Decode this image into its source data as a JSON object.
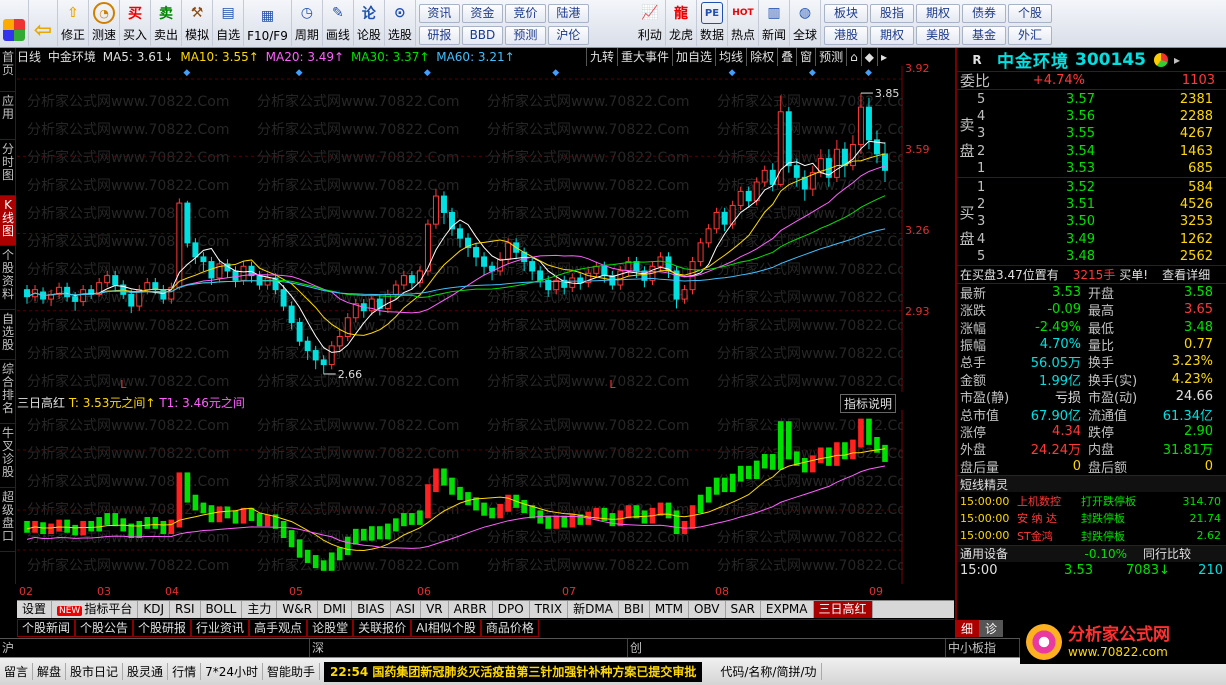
{
  "toolbar": {
    "big_buttons": [
      {
        "label": "",
        "icon": "menu-icon"
      },
      {
        "label": "",
        "icon": "back-arrow-icon"
      },
      {
        "label": "修正",
        "icon": "up-arrow-icon"
      },
      {
        "label": "测速",
        "icon": "clock-icon"
      },
      {
        "label": "买入",
        "icon": "buy-icon"
      },
      {
        "label": "卖出",
        "icon": "sell-icon"
      },
      {
        "label": "模拟",
        "icon": "hammer-icon"
      },
      {
        "label": "自选",
        "icon": "star-icon"
      },
      {
        "label": "F10/F9",
        "icon": "f10-icon"
      },
      {
        "label": "周期",
        "icon": "period-icon"
      },
      {
        "label": "画线",
        "icon": "pen-icon"
      },
      {
        "label": "论股",
        "icon": "forum-icon"
      },
      {
        "label": "选股",
        "icon": "select-icon"
      }
    ],
    "grid1": [
      "资讯",
      "资金",
      "竞价",
      "陆港",
      "研报",
      "BBD",
      "预测",
      "沪伦"
    ],
    "big_buttons2": [
      {
        "label": "利动",
        "icon": "chart-icon"
      },
      {
        "label": "龙虎",
        "icon": "dragon-icon"
      },
      {
        "label": "数据",
        "icon": "pe-icon"
      },
      {
        "label": "热点",
        "icon": "hot-icon"
      },
      {
        "label": "新闻",
        "icon": "news-icon"
      },
      {
        "label": "全球",
        "icon": "globe-icon"
      }
    ],
    "grid2": [
      "板块",
      "股指",
      "期权",
      "债券",
      "个股",
      "港股",
      "期权",
      "美股",
      "基金",
      "外汇"
    ]
  },
  "left_tabs": [
    "首页",
    "应用",
    "分时图",
    "K线图",
    "个股资料",
    "自选股",
    "综合排名",
    "牛叉诊股",
    "超级盘口"
  ],
  "chart": {
    "header": {
      "period": "日线",
      "name": "中金环境",
      "ma5": "MA5: 3.61↓",
      "ma10": "MA10: 3.55↑",
      "ma20": "MA20: 3.49↑",
      "ma30": "MA30: 3.37↑",
      "ma60": "MA60: 3.21↑"
    },
    "tools": [
      "九转",
      "重大事件",
      "加自选",
      "均线",
      "除权",
      "叠",
      "窗",
      "预测",
      "⌂",
      "◆",
      "▸"
    ],
    "price_axis": [
      "3.92",
      "3.59",
      "3.26",
      "2.93"
    ],
    "high_label": "3.85",
    "low_label": "2.66",
    "watermark": "分析家公式网www.70822.Com",
    "sub_header": {
      "name": "三日高红",
      "t": "T: 3.53元之间↑",
      "t1": "T1: 3.46元之间"
    },
    "sub_button": "指标说明",
    "x_dates": [
      "02",
      "03",
      "04",
      "05",
      "06",
      "07",
      "08",
      "09"
    ]
  },
  "chart_data": {
    "type": "candlestick",
    "title": "中金环境 日线",
    "ylim": [
      2.6,
      3.95
    ],
    "candles": [
      {
        "o": 3.02,
        "c": 2.99,
        "h": 3.04,
        "l": 2.96
      },
      {
        "o": 2.99,
        "c": 3.02,
        "h": 3.04,
        "l": 2.97
      },
      {
        "o": 3.01,
        "c": 2.98,
        "h": 3.03,
        "l": 2.96
      },
      {
        "o": 2.98,
        "c": 3.0,
        "h": 3.02,
        "l": 2.95
      },
      {
        "o": 3.0,
        "c": 3.03,
        "h": 3.05,
        "l": 2.98
      },
      {
        "o": 3.03,
        "c": 2.99,
        "h": 3.05,
        "l": 2.97
      },
      {
        "o": 2.99,
        "c": 2.97,
        "h": 3.01,
        "l": 2.93
      },
      {
        "o": 2.97,
        "c": 3.02,
        "h": 3.04,
        "l": 2.95
      },
      {
        "o": 3.02,
        "c": 3.0,
        "h": 3.04,
        "l": 2.98
      },
      {
        "o": 3.0,
        "c": 3.05,
        "h": 3.07,
        "l": 2.99
      },
      {
        "o": 3.05,
        "c": 3.08,
        "h": 3.1,
        "l": 3.03
      },
      {
        "o": 3.08,
        "c": 3.04,
        "h": 3.1,
        "l": 3.01
      },
      {
        "o": 3.04,
        "c": 3.0,
        "h": 3.06,
        "l": 2.98
      },
      {
        "o": 3.0,
        "c": 2.95,
        "h": 3.02,
        "l": 2.92
      },
      {
        "o": 2.95,
        "c": 3.02,
        "h": 3.04,
        "l": 2.93
      },
      {
        "o": 3.02,
        "c": 3.05,
        "h": 3.07,
        "l": 3.0
      },
      {
        "o": 3.05,
        "c": 3.02,
        "h": 3.07,
        "l": 3.0
      },
      {
        "o": 3.02,
        "c": 2.98,
        "h": 3.04,
        "l": 2.96
      },
      {
        "o": 2.98,
        "c": 3.03,
        "h": 3.05,
        "l": 2.96
      },
      {
        "o": 3.03,
        "c": 3.39,
        "h": 3.41,
        "l": 3.02
      },
      {
        "o": 3.39,
        "c": 3.22,
        "h": 3.4,
        "l": 3.2
      },
      {
        "o": 3.22,
        "c": 3.16,
        "h": 3.24,
        "l": 3.13
      },
      {
        "o": 3.16,
        "c": 3.14,
        "h": 3.18,
        "l": 3.1
      },
      {
        "o": 3.14,
        "c": 3.07,
        "h": 3.16,
        "l": 3.04
      },
      {
        "o": 3.07,
        "c": 3.13,
        "h": 3.15,
        "l": 3.05
      },
      {
        "o": 3.13,
        "c": 3.1,
        "h": 3.15,
        "l": 3.07
      },
      {
        "o": 3.1,
        "c": 3.06,
        "h": 3.12,
        "l": 3.03
      },
      {
        "o": 3.06,
        "c": 3.12,
        "h": 3.14,
        "l": 3.04
      },
      {
        "o": 3.12,
        "c": 3.08,
        "h": 3.14,
        "l": 3.05
      },
      {
        "o": 3.08,
        "c": 3.04,
        "h": 3.1,
        "l": 3.02
      },
      {
        "o": 3.04,
        "c": 3.07,
        "h": 3.09,
        "l": 3.02
      },
      {
        "o": 3.07,
        "c": 3.02,
        "h": 3.09,
        "l": 3.0
      },
      {
        "o": 3.02,
        "c": 2.95,
        "h": 3.04,
        "l": 2.93
      },
      {
        "o": 2.95,
        "c": 2.88,
        "h": 2.97,
        "l": 2.85
      },
      {
        "o": 2.88,
        "c": 2.8,
        "h": 2.9,
        "l": 2.78
      },
      {
        "o": 2.8,
        "c": 2.76,
        "h": 2.82,
        "l": 2.72
      },
      {
        "o": 2.76,
        "c": 2.72,
        "h": 2.78,
        "l": 2.68
      },
      {
        "o": 2.72,
        "c": 2.7,
        "h": 2.74,
        "l": 2.66
      },
      {
        "o": 2.7,
        "c": 2.78,
        "h": 2.8,
        "l": 2.68
      },
      {
        "o": 2.78,
        "c": 2.82,
        "h": 2.85,
        "l": 2.76
      },
      {
        "o": 2.82,
        "c": 2.9,
        "h": 2.92,
        "l": 2.8
      },
      {
        "o": 2.9,
        "c": 2.96,
        "h": 2.98,
        "l": 2.88
      },
      {
        "o": 2.96,
        "c": 2.93,
        "h": 2.98,
        "l": 2.9
      },
      {
        "o": 2.93,
        "c": 2.98,
        "h": 3.0,
        "l": 2.91
      },
      {
        "o": 2.98,
        "c": 2.94,
        "h": 3.0,
        "l": 2.91
      },
      {
        "o": 2.94,
        "c": 3.0,
        "h": 3.02,
        "l": 2.92
      },
      {
        "o": 3.0,
        "c": 3.04,
        "h": 3.06,
        "l": 2.98
      },
      {
        "o": 3.04,
        "c": 3.08,
        "h": 3.1,
        "l": 3.02
      },
      {
        "o": 3.08,
        "c": 3.05,
        "h": 3.1,
        "l": 3.02
      },
      {
        "o": 3.05,
        "c": 3.1,
        "h": 3.12,
        "l": 3.03
      },
      {
        "o": 3.1,
        "c": 3.3,
        "h": 3.32,
        "l": 3.08
      },
      {
        "o": 3.3,
        "c": 3.42,
        "h": 3.45,
        "l": 3.28
      },
      {
        "o": 3.42,
        "c": 3.35,
        "h": 3.44,
        "l": 3.3
      },
      {
        "o": 3.35,
        "c": 3.28,
        "h": 3.37,
        "l": 3.25
      },
      {
        "o": 3.28,
        "c": 3.24,
        "h": 3.3,
        "l": 3.2
      },
      {
        "o": 3.24,
        "c": 3.2,
        "h": 3.26,
        "l": 3.16
      },
      {
        "o": 3.2,
        "c": 3.16,
        "h": 3.22,
        "l": 3.12
      },
      {
        "o": 3.16,
        "c": 3.12,
        "h": 3.18,
        "l": 3.08
      },
      {
        "o": 3.12,
        "c": 3.1,
        "h": 3.14,
        "l": 3.06
      },
      {
        "o": 3.1,
        "c": 3.15,
        "h": 3.18,
        "l": 3.08
      },
      {
        "o": 3.15,
        "c": 3.22,
        "h": 3.24,
        "l": 3.13
      },
      {
        "o": 3.22,
        "c": 3.18,
        "h": 3.24,
        "l": 3.15
      },
      {
        "o": 3.18,
        "c": 3.14,
        "h": 3.2,
        "l": 3.1
      },
      {
        "o": 3.14,
        "c": 3.1,
        "h": 3.16,
        "l": 3.06
      },
      {
        "o": 3.1,
        "c": 3.06,
        "h": 3.12,
        "l": 3.03
      },
      {
        "o": 3.06,
        "c": 3.02,
        "h": 3.08,
        "l": 2.99
      },
      {
        "o": 3.02,
        "c": 3.06,
        "h": 3.08,
        "l": 3.0
      },
      {
        "o": 3.06,
        "c": 3.03,
        "h": 3.08,
        "l": 3.0
      },
      {
        "o": 3.03,
        "c": 3.07,
        "h": 3.09,
        "l": 3.01
      },
      {
        "o": 3.07,
        "c": 3.05,
        "h": 3.09,
        "l": 3.02
      },
      {
        "o": 3.05,
        "c": 3.09,
        "h": 3.11,
        "l": 3.03
      },
      {
        "o": 3.09,
        "c": 3.12,
        "h": 3.14,
        "l": 3.07
      },
      {
        "o": 3.12,
        "c": 3.08,
        "h": 3.14,
        "l": 3.05
      },
      {
        "o": 3.08,
        "c": 3.04,
        "h": 3.1,
        "l": 3.02
      },
      {
        "o": 3.04,
        "c": 3.1,
        "h": 3.12,
        "l": 3.02
      },
      {
        "o": 3.1,
        "c": 3.14,
        "h": 3.16,
        "l": 3.08
      },
      {
        "o": 3.14,
        "c": 3.1,
        "h": 3.16,
        "l": 3.07
      },
      {
        "o": 3.1,
        "c": 3.06,
        "h": 3.12,
        "l": 3.03
      },
      {
        "o": 3.06,
        "c": 3.12,
        "h": 3.14,
        "l": 3.04
      },
      {
        "o": 3.12,
        "c": 3.16,
        "h": 3.18,
        "l": 3.1
      },
      {
        "o": 3.16,
        "c": 3.1,
        "h": 3.18,
        "l": 3.07
      },
      {
        "o": 3.1,
        "c": 2.98,
        "h": 3.12,
        "l": 2.94
      },
      {
        "o": 2.98,
        "c": 3.02,
        "h": 3.04,
        "l": 2.96
      },
      {
        "o": 3.02,
        "c": 3.14,
        "h": 3.16,
        "l": 3.0
      },
      {
        "o": 3.14,
        "c": 3.22,
        "h": 3.24,
        "l": 3.12
      },
      {
        "o": 3.22,
        "c": 3.28,
        "h": 3.3,
        "l": 3.2
      },
      {
        "o": 3.28,
        "c": 3.35,
        "h": 3.37,
        "l": 3.26
      },
      {
        "o": 3.35,
        "c": 3.3,
        "h": 3.37,
        "l": 3.27
      },
      {
        "o": 3.3,
        "c": 3.38,
        "h": 3.4,
        "l": 3.28
      },
      {
        "o": 3.38,
        "c": 3.44,
        "h": 3.46,
        "l": 3.36
      },
      {
        "o": 3.44,
        "c": 3.4,
        "h": 3.46,
        "l": 3.37
      },
      {
        "o": 3.4,
        "c": 3.48,
        "h": 3.5,
        "l": 3.38
      },
      {
        "o": 3.48,
        "c": 3.53,
        "h": 3.55,
        "l": 3.46
      },
      {
        "o": 3.53,
        "c": 3.47,
        "h": 3.56,
        "l": 3.44
      },
      {
        "o": 3.47,
        "c": 3.78,
        "h": 3.85,
        "l": 3.46
      },
      {
        "o": 3.78,
        "c": 3.55,
        "h": 3.8,
        "l": 3.52
      },
      {
        "o": 3.55,
        "c": 3.5,
        "h": 3.58,
        "l": 3.46
      },
      {
        "o": 3.5,
        "c": 3.45,
        "h": 3.53,
        "l": 3.4
      },
      {
        "o": 3.45,
        "c": 3.52,
        "h": 3.55,
        "l": 3.42
      },
      {
        "o": 3.52,
        "c": 3.58,
        "h": 3.62,
        "l": 3.5
      },
      {
        "o": 3.58,
        "c": 3.5,
        "h": 3.62,
        "l": 3.46
      },
      {
        "o": 3.5,
        "c": 3.62,
        "h": 3.66,
        "l": 3.48
      },
      {
        "o": 3.62,
        "c": 3.55,
        "h": 3.65,
        "l": 3.5
      },
      {
        "o": 3.55,
        "c": 3.64,
        "h": 3.68,
        "l": 3.53
      },
      {
        "o": 3.64,
        "c": 3.8,
        "h": 3.86,
        "l": 3.6
      },
      {
        "o": 3.8,
        "c": 3.66,
        "h": 3.84,
        "l": 3.62
      },
      {
        "o": 3.66,
        "c": 3.6,
        "h": 3.7,
        "l": 3.56
      },
      {
        "o": 3.6,
        "c": 3.53,
        "h": 3.65,
        "l": 3.48
      }
    ],
    "sub_bars": [
      1,
      1,
      1,
      1,
      1,
      1,
      1,
      1,
      1,
      0,
      0,
      0,
      0,
      0,
      0,
      0,
      0,
      1,
      1,
      1,
      1,
      1,
      1,
      1,
      1,
      1,
      1,
      1,
      1,
      1,
      1,
      1,
      1,
      1,
      1,
      1,
      1,
      1,
      0,
      0,
      0,
      0,
      0,
      0,
      0,
      0,
      0,
      0,
      0,
      0,
      1,
      1,
      1,
      1,
      1,
      1,
      1,
      1,
      1,
      1,
      1,
      1,
      1,
      1,
      1,
      1,
      1,
      1,
      1,
      1,
      1,
      1,
      1,
      1,
      1,
      1,
      1,
      1,
      1,
      1,
      1,
      1,
      1,
      1,
      0,
      0,
      0,
      0,
      0,
      0,
      0,
      0,
      0,
      0,
      0,
      1,
      1,
      1,
      1,
      1,
      1,
      1,
      1,
      1,
      1,
      1,
      1
    ]
  },
  "panel": {
    "R": "R",
    "name": "中金环境",
    "code": "300145",
    "weibi_label": "委比",
    "weibi_pct": "+4.74%",
    "weibi_val": "1103",
    "sell_label": "卖盘",
    "buy_label": "买盘",
    "sells": [
      {
        "lvl": "5",
        "price": "3.57",
        "vol": "2381"
      },
      {
        "lvl": "4",
        "price": "3.56",
        "vol": "2288"
      },
      {
        "lvl": "3",
        "price": "3.55",
        "vol": "4267"
      },
      {
        "lvl": "2",
        "price": "3.54",
        "vol": "1463"
      },
      {
        "lvl": "1",
        "price": "3.53",
        "vol": "685"
      }
    ],
    "buys": [
      {
        "lvl": "1",
        "price": "3.52",
        "vol": "584"
      },
      {
        "lvl": "2",
        "price": "3.51",
        "vol": "4526"
      },
      {
        "lvl": "3",
        "price": "3.50",
        "vol": "3253"
      },
      {
        "lvl": "4",
        "price": "3.49",
        "vol": "1262"
      },
      {
        "lvl": "5",
        "price": "3.48",
        "vol": "2562"
      }
    ],
    "big_order": {
      "text": "在买盘3.47位置有",
      "vol": "3215手",
      "label": "买单!",
      "detail": "查看详细"
    },
    "quotes": [
      {
        "l1": "最新",
        "v1": "3.53",
        "c1": "green",
        "l2": "开盘",
        "v2": "3.58",
        "c2": "green"
      },
      {
        "l1": "涨跌",
        "v1": "-0.09",
        "c1": "green",
        "l2": "最高",
        "v2": "3.65",
        "c2": "red"
      },
      {
        "l1": "涨幅",
        "v1": "-2.49%",
        "c1": "green",
        "l2": "最低",
        "v2": "3.48",
        "c2": "green"
      },
      {
        "l1": "振幅",
        "v1": "4.70%",
        "c1": "cyan",
        "l2": "量比",
        "v2": "0.77",
        "c2": "yellow"
      },
      {
        "l1": "总手",
        "v1": "56.05万",
        "c1": "cyan",
        "l2": "换手",
        "v2": "3.23%",
        "c2": "yellow"
      },
      {
        "l1": "金额",
        "v1": "1.99亿",
        "c1": "cyan",
        "l2": "换手(实)",
        "v2": "4.23%",
        "c2": "yellow"
      },
      {
        "l1": "市盈(静)",
        "v1": "亏损",
        "c1": "white",
        "l2": "市盈(动)",
        "v2": "24.66",
        "c2": "white"
      },
      {
        "l1": "总市值",
        "v1": "67.90亿",
        "c1": "cyan",
        "l2": "流通值",
        "v2": "61.34亿",
        "c2": "cyan"
      },
      {
        "l1": "涨停",
        "v1": "4.34",
        "c1": "red",
        "l2": "跌停",
        "v2": "2.90",
        "c2": "green"
      },
      {
        "l1": "外盘",
        "v1": "24.24万",
        "c1": "red",
        "l2": "内盘",
        "v2": "31.81万",
        "c2": "green"
      },
      {
        "l1": "盘后量",
        "v1": "0",
        "c1": "yellow",
        "l2": "盘后额",
        "v2": "0",
        "c2": "yellow"
      }
    ],
    "short_title": "短线精灵",
    "short_rows": [
      {
        "time": "15:00:00",
        "name": "上机数控",
        "event": "打开跌停板",
        "val": "314.70"
      },
      {
        "time": "15:00:00",
        "name": "安 纳 达",
        "event": "封跌停板",
        "val": "21.74"
      },
      {
        "time": "15:00:00",
        "name": "ST金鸿",
        "event": "封跌停板",
        "val": "2.62"
      }
    ],
    "sector": {
      "name": "通用设备",
      "pct": "-0.10%",
      "compare": "同行比较"
    },
    "tick": {
      "time": "15:00",
      "price": "3.53",
      "vol": "7083",
      "count": "210"
    }
  },
  "indicator_tabs": [
    "设置",
    "NEW",
    "指标平台",
    "KDJ",
    "RSI",
    "BOLL",
    "主力",
    "W&R",
    "DMI",
    "BIAS",
    "ASI",
    "VR",
    "ARBR",
    "DPO",
    "TRIX",
    "新DMA",
    "BBI",
    "MTM",
    "OBV",
    "SAR",
    "EXPMA",
    "三日高红"
  ],
  "info_tabs": [
    "个股新闻",
    "个股公告",
    "个股研报",
    "行业资讯",
    "高手观点",
    "论股堂",
    "关联报价",
    "AI相似个股",
    "商品价格"
  ],
  "index_bar": [
    "沪",
    "深",
    "创",
    "中小板指"
  ],
  "status": {
    "items": [
      "留言",
      "解盘",
      "股市日记",
      "股灵通",
      "行情",
      "7*24小时",
      "智能助手"
    ],
    "news": "22:54 国药集团新冠肺炎灭活疫苗第三针加强针补种方案已提交审批",
    "right": "代码/名称/简拼/功"
  },
  "right_tabs": [
    "细",
    "诊"
  ],
  "logo": {
    "name": "分析家公式网",
    "url": "www.70822.com"
  },
  "colors": {
    "up": "#ff3838",
    "down": "#00e0e0",
    "ma5": "#ffffff",
    "ma10": "#ffd800",
    "ma20": "#ff60ff",
    "ma30": "#00e000",
    "ma60": "#40c0ff"
  }
}
